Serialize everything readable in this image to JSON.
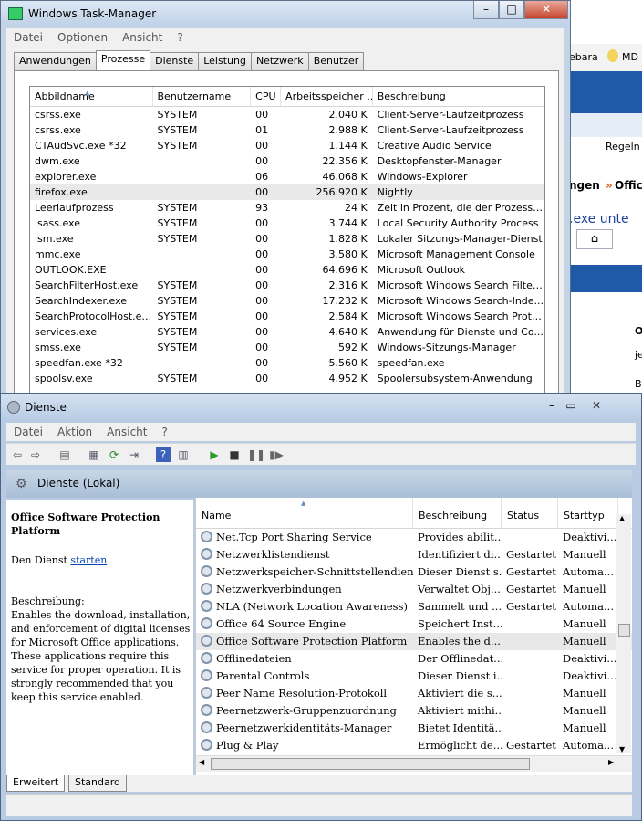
{
  "browser": {
    "home_icon": "home-icon",
    "frag1": "ebara",
    "frag2": "MD",
    "frag3": "Regeln",
    "frag4": "ngen",
    "frag5": "Office",
    "frag6": ".exe unte",
    "frag7": "O",
    "frag8": "je",
    "frag9": "B"
  },
  "taskmanager": {
    "title": "Windows Task-Manager",
    "menu": [
      "Datei",
      "Optionen",
      "Ansicht",
      "?"
    ],
    "tabs": [
      "Anwendungen",
      "Prozesse",
      "Dienste",
      "Leistung",
      "Netzwerk",
      "Benutzer"
    ],
    "columns": [
      "Abbildname",
      "Benutzername",
      "CPU",
      "Arbeitsspeicher ...",
      "Beschreibung"
    ],
    "rows": [
      [
        "csrss.exe",
        "SYSTEM",
        "00",
        "2.040 K",
        "Client-Server-Laufzeitprozess"
      ],
      [
        "csrss.exe",
        "SYSTEM",
        "01",
        "2.988 K",
        "Client-Server-Laufzeitprozess"
      ],
      [
        "CTAudSvc.exe *32",
        "SYSTEM",
        "00",
        "1.144 K",
        "Creative Audio Service"
      ],
      [
        "dwm.exe",
        "",
        "00",
        "22.356 K",
        "Desktopfenster-Manager"
      ],
      [
        "explorer.exe",
        "",
        "06",
        "46.068 K",
        "Windows-Explorer"
      ],
      [
        "firefox.exe",
        "",
        "00",
        "256.920 K",
        "Nightly"
      ],
      [
        "Leerlaufprozess",
        "SYSTEM",
        "93",
        "24 K",
        "Zeit in Prozent, die der Prozesso..."
      ],
      [
        "lsass.exe",
        "SYSTEM",
        "00",
        "3.744 K",
        "Local Security Authority Process"
      ],
      [
        "lsm.exe",
        "SYSTEM",
        "00",
        "1.828 K",
        "Lokaler Sitzungs-Manager-Dienst"
      ],
      [
        "mmc.exe",
        "",
        "00",
        "3.580 K",
        "Microsoft Management Console"
      ],
      [
        "OUTLOOK.EXE",
        "",
        "00",
        "64.696 K",
        "Microsoft Outlook"
      ],
      [
        "SearchFilterHost.exe",
        "SYSTEM",
        "00",
        "2.316 K",
        "Microsoft Windows Search Filter..."
      ],
      [
        "SearchIndexer.exe",
        "SYSTEM",
        "00",
        "17.232 K",
        "Microsoft Windows Search-Inde..."
      ],
      [
        "SearchProtocolHost.exe",
        "SYSTEM",
        "00",
        "2.584 K",
        "Microsoft Windows Search Proto..."
      ],
      [
        "services.exe",
        "SYSTEM",
        "00",
        "4.640 K",
        "Anwendung für Dienste und Co..."
      ],
      [
        "smss.exe",
        "SYSTEM",
        "00",
        "592 K",
        "Windows-Sitzungs-Manager"
      ],
      [
        "speedfan.exe *32",
        "",
        "00",
        "5.560 K",
        "speedfan.exe"
      ],
      [
        "spoolsv.exe",
        "SYSTEM",
        "00",
        "4.952 K",
        "Spoolersubsystem-Anwendung"
      ]
    ]
  },
  "services": {
    "title": "Dienste",
    "menu": [
      "Datei",
      "Aktion",
      "Ansicht",
      "?"
    ],
    "header_label": "Dienste (Lokal)",
    "selected_title": "Office Software Protection Platform",
    "action_prefix": "Den Dienst",
    "action_link": "starten",
    "desc_label": "Beschreibung:",
    "description": "Enables the download, installation, and enforcement of digital licenses for Microsoft Office applications. These applications require this service for proper operation. It is strongly recommended that you keep this service enabled.",
    "columns": [
      "Name",
      "Beschreibung",
      "Status",
      "Starttyp"
    ],
    "rows": [
      [
        "Net.Tcp Port Sharing Service",
        "Provides abilit...",
        "",
        "Deaktivi..."
      ],
      [
        "Netzwerklistendienst",
        "Identifiziert di...",
        "Gestartet",
        "Manuell"
      ],
      [
        "Netzwerkspeicher-Schnittstellendienst",
        "Dieser Dienst s...",
        "Gestartet",
        "Automa..."
      ],
      [
        "Netzwerkverbindungen",
        "Verwaltet Obj...",
        "Gestartet",
        "Manuell"
      ],
      [
        "NLA (Network Location Awareness)",
        "Sammelt und ...",
        "Gestartet",
        "Automa..."
      ],
      [
        "Office 64 Source Engine",
        "Speichert Inst...",
        "",
        "Manuell"
      ],
      [
        "Office Software Protection Platform",
        "Enables the d...",
        "",
        "Manuell"
      ],
      [
        "Offlinedateien",
        "Der Offlinedat...",
        "",
        "Deaktivi..."
      ],
      [
        "Parental Controls",
        "Dieser Dienst i...",
        "",
        "Deaktivi..."
      ],
      [
        "Peer Name Resolution-Protokoll",
        "Aktiviert die s...",
        "",
        "Manuell"
      ],
      [
        "Peernetzwerk-Gruppenzuordnung",
        "Aktiviert mithi...",
        "",
        "Manuell"
      ],
      [
        "Peernetzwerkidentitäts-Manager",
        "Bietet Identitä...",
        "",
        "Manuell"
      ],
      [
        "Plug & Play",
        "Ermöglicht de...",
        "Gestartet",
        "Automa..."
      ]
    ],
    "bottom_tabs": [
      "Erweitert",
      "Standard"
    ]
  }
}
